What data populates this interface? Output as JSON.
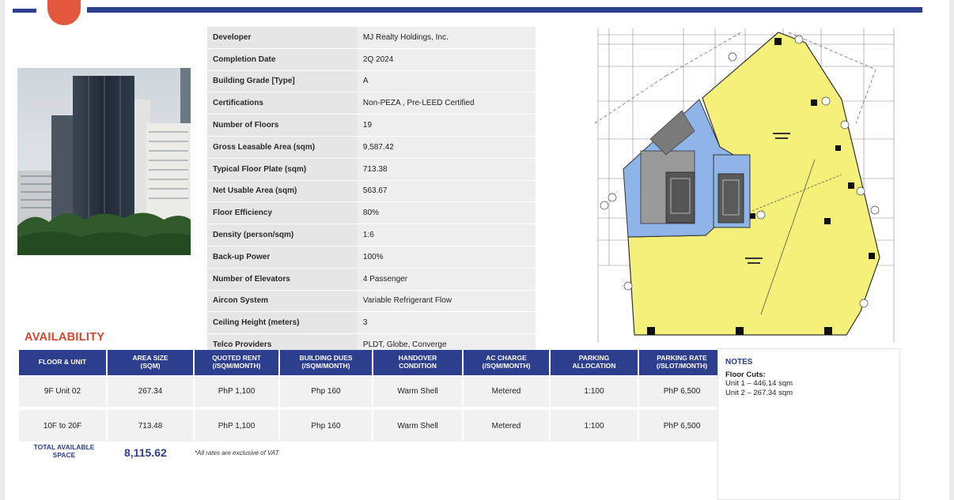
{
  "specs": [
    {
      "label": "Developer",
      "value": "MJ Realty Holdings, Inc."
    },
    {
      "label": "Completion Date",
      "value": "2Q 2024"
    },
    {
      "label": "Building Grade [Type]",
      "value": "A"
    },
    {
      "label": "Certifications",
      "value": "Non-PEZA , Pre-LEED Certified"
    },
    {
      "label": "Number of Floors",
      "value": "19"
    },
    {
      "label": "Gross Leasable Area (sqm)",
      "value": "9,587.42"
    },
    {
      "label": "Typical Floor Plate (sqm)",
      "value": "713.38"
    },
    {
      "label": "Net Usable Area (sqm)",
      "value": "563.67"
    },
    {
      "label": "Floor Efficiency",
      "value": "80%"
    },
    {
      "label": "Density (person/sqm)",
      "value": "1:6"
    },
    {
      "label": "Back-up Power",
      "value": "100%"
    },
    {
      "label": "Number of Elevators",
      "value": "4 Passenger"
    },
    {
      "label": "Aircon System",
      "value": "Variable Refrigerant Flow"
    },
    {
      "label": "Ceiling Height (meters)",
      "value": "3"
    },
    {
      "label": "Telco Providers",
      "value": "PLDT, Globe, Converge"
    }
  ],
  "availability": {
    "title": "AVAILABILITY",
    "headers": [
      {
        "l1": "FLOOR & UNIT",
        "l2": ""
      },
      {
        "l1": "AREA SIZE",
        "l2": "(SQM)"
      },
      {
        "l1": "QUOTED RENT",
        "l2": "(/sqm/month)"
      },
      {
        "l1": "BUILDING DUES",
        "l2": "(/sqm/month)"
      },
      {
        "l1": "HANDOVER",
        "l2": "CONDITION"
      },
      {
        "l1": "AC CHARGE",
        "l2": "(/sqm/month)"
      },
      {
        "l1": "PARKING",
        "l2": "ALLOCATION"
      },
      {
        "l1": "PARKING RATE",
        "l2": "(/slot/month)"
      }
    ],
    "rows": [
      [
        "9F Unit 02",
        "267.34",
        "PhP 1,100",
        "Php 160",
        "Warm Shell",
        "Metered",
        "1:100",
        "PhP 6,500"
      ],
      [
        "10F to 20F",
        "713.48",
        "PhP 1,100",
        "Php 160",
        "Warm Shell",
        "Metered",
        "1:100",
        "PhP 6,500"
      ]
    ],
    "total_label_1": "TOTAL AVAILABLE",
    "total_label_2": "SPACE",
    "total_value": "8,115.62",
    "vat_note": "*All rates are exclusive of VAT"
  },
  "notes": {
    "title": "NOTES",
    "heading": "Floor Cuts:",
    "lines": [
      "Unit 1 – 446.14 sqm",
      "Unit 2 – 267.34 sqm"
    ]
  },
  "colors": {
    "brand": "#2d3e8f",
    "accent": "#d1472f",
    "plan_yellow": "#f5f07a",
    "plan_blue": "#8fb4e8"
  },
  "icons": [
    "building-photo",
    "floor-plan"
  ]
}
